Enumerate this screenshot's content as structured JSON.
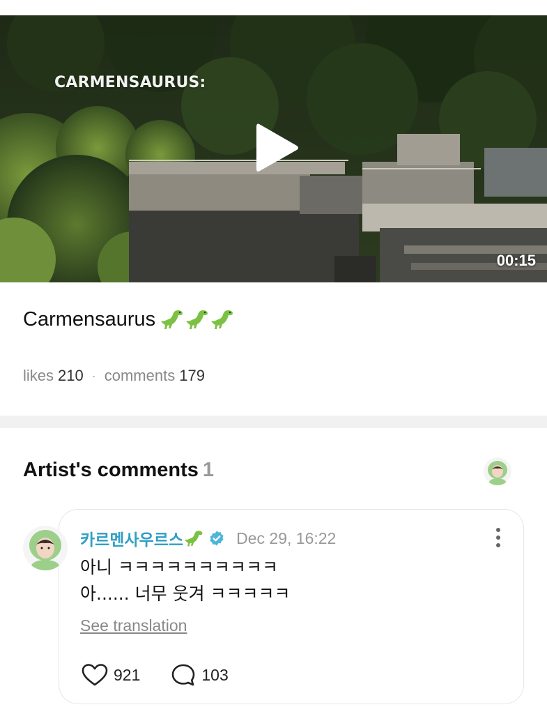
{
  "video": {
    "overlay_text": "CARMENSAURUS:",
    "duration": "00:15"
  },
  "post": {
    "title": "Carmensaurus",
    "title_emoji": "dinosaur-icon x3",
    "likes_label": "likes",
    "likes_count": "210",
    "separator": "·",
    "comments_label": "comments",
    "comments_count": "179"
  },
  "artist_comments": {
    "heading": "Artist's comments",
    "count": "1"
  },
  "comment": {
    "author": "카르멘사우르스",
    "author_emoji": "dinosaur-icon",
    "verified": true,
    "date": "Dec 29, 16:22",
    "line1": "아니 ㅋㅋㅋㅋㅋㅋㅋㅋㅋㅋ",
    "line2": "아...... 너무 웃겨 ㅋㅋㅋㅋㅋ",
    "see_translation": "See translation",
    "likes": "921",
    "replies": "103"
  },
  "colors": {
    "author": "#2f9fc4",
    "verified": "#4cb6d8",
    "muted": "#888888",
    "divider": "#f1f1f1"
  }
}
